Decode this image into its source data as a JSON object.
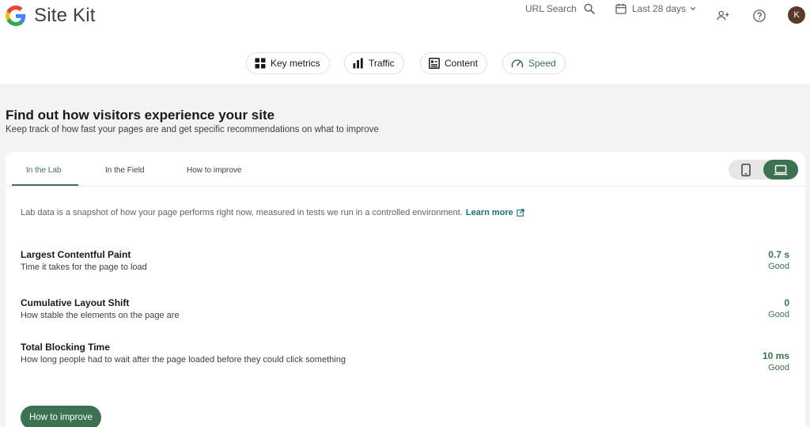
{
  "header": {
    "app_name": "Site Kit",
    "url_search_label": "URL Search",
    "date_range_label": "Last 28 days",
    "avatar_initial": "K"
  },
  "nav": {
    "chips": [
      {
        "label": "Key metrics",
        "icon": "grid-icon"
      },
      {
        "label": "Traffic",
        "icon": "bar-chart-icon"
      },
      {
        "label": "Content",
        "icon": "article-icon"
      },
      {
        "label": "Speed",
        "icon": "speedometer-icon",
        "active": true
      }
    ]
  },
  "section": {
    "title": "Find out how visitors experience your site",
    "subtitle": "Keep track of how fast your pages are and get specific recommendations on what to improve"
  },
  "tabs": [
    {
      "label": "In the Lab",
      "active": true
    },
    {
      "label": "In the Field"
    },
    {
      "label": "How to improve"
    }
  ],
  "device_toggle": {
    "selected": "desktop"
  },
  "lab_info": {
    "text": "Lab data is a snapshot of how your page performs right now, measured in tests we run in a controlled environment.",
    "link": "Learn more"
  },
  "metrics": [
    {
      "name": "Largest Contentful Paint",
      "description": "Time it takes for the page to load",
      "value": "0.7 s",
      "rating": "Good"
    },
    {
      "name": "Cumulative Layout Shift",
      "description": "How stable the elements on the page are",
      "value": "0",
      "rating": "Good"
    },
    {
      "name": "Total Blocking Time",
      "description": "How long people had to wait after the page loaded before they could click something",
      "value": "10 ms",
      "rating": "Good"
    }
  ],
  "actions": {
    "improve_button": "How to improve"
  },
  "colors": {
    "accent": "#3c7251",
    "link": "#1d6f7a",
    "background": "#f3f3f3"
  }
}
